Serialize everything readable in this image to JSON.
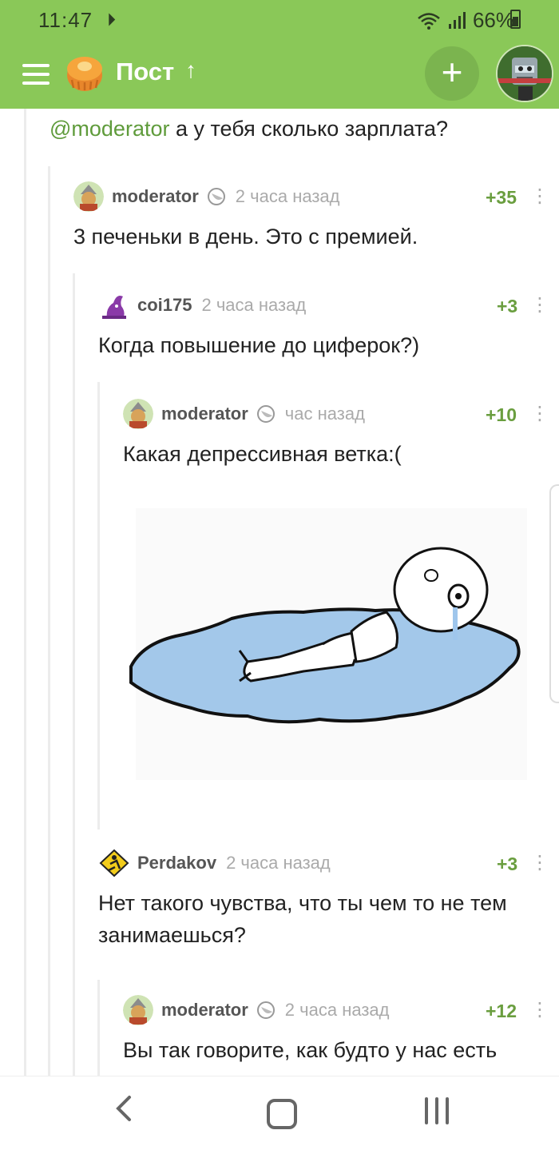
{
  "status": {
    "time": "11:47",
    "battery": "66%"
  },
  "header": {
    "title": "Пост"
  },
  "comments": [
    {
      "text_mention": "@moderator",
      "text": " а у тебя сколько зарплата?"
    },
    {
      "author": "moderator",
      "time": "2 часа назад",
      "rating": "+35",
      "text": "3 печеньки в день. Это с премией."
    },
    {
      "author": "coi175",
      "time": "2 часа назад",
      "rating": "+3",
      "text": "Когда повышение до циферок?)"
    },
    {
      "author": "moderator",
      "time": "час назад",
      "rating": "+10",
      "text": "Какая депрессивная ветка:("
    },
    {
      "author": "Perdakov",
      "time": "2 часа назад",
      "rating": "+3",
      "text": "Нет такого чувства, что ты чем то не тем занимаешься?"
    },
    {
      "author": "moderator",
      "time": "2 часа назад",
      "rating": "+12",
      "text": "Вы так говорите, как будто у нас есть"
    }
  ],
  "colors": {
    "accent": "#8ac858",
    "rating": "#6a9e3f"
  },
  "icons": {
    "menu": "hamburger-icon",
    "add": "plus-icon",
    "up": "up-arrow-icon",
    "more": "more-vertical-icon"
  }
}
